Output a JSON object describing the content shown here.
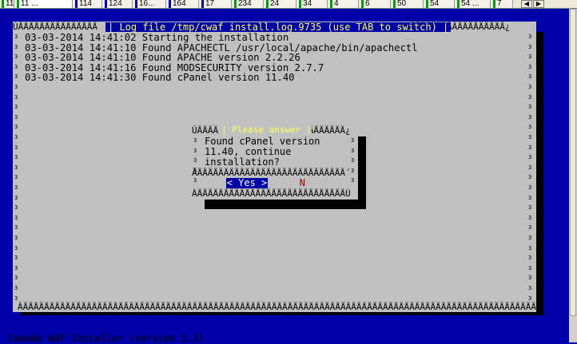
{
  "tabs": [
    {
      "label": "11",
      "mark": "#00a000"
    },
    {
      "label": "11 ...",
      "mark": "#00a000",
      "active": true
    },
    {
      "label": "114",
      "mark": "#0000c0"
    },
    {
      "label": "124",
      "mark": "#0000c0"
    },
    {
      "label": "16...",
      "mark": "#0000c0"
    },
    {
      "label": "164",
      "mark": "#0000c0"
    },
    {
      "label": "17",
      "mark": "#0000c0"
    },
    {
      "label": "234",
      "mark": "#00a000"
    },
    {
      "label": "24",
      "mark": "#00a000"
    },
    {
      "label": "34",
      "mark": "#00a000"
    },
    {
      "label": "4",
      "mark": "#00a000"
    },
    {
      "label": "6",
      "mark": "#00a000"
    },
    {
      "label": "50",
      "mark": "#00a000"
    },
    {
      "label": "54",
      "mark": "#00a000"
    },
    {
      "label": "54 ...",
      "mark": "#00a000"
    },
    {
      "label": "7",
      "mark": "#00a000"
    }
  ],
  "nav": {
    "prev_icon": "◀",
    "next_icon": "▶"
  },
  "log": {
    "title": "| Log file /tmp/cwaf_install.log.9735 (use TAB to switch) |",
    "lines": [
      "03-03-2014 14:41:02 Starting the installation",
      "03-03-2014 14:41:10 Found APACHECTL /usr/local/apache/bin/apachectl",
      "03-03-2014 14:41:10 Found APACHE version 2.2.26",
      "03-03-2014 14:41:16 Found MODSECURITY version 2.7.7",
      "03-03-2014 14:41:30 Found cPanel version 11.40"
    ]
  },
  "dialog": {
    "title": "| Please answer |",
    "lines": [
      "Found cPanel version",
      "11.40, continue",
      "installation?"
    ],
    "yes_label": "< Yes >",
    "no_left": "<  ",
    "no_hot": "N",
    "no_rest": "o  >"
  },
  "status": {
    "text": "Comodo WAF Installer (version 1.3)"
  },
  "colors": {
    "terminal_bg": "#0000a8",
    "window_bg": "#c0c0c0",
    "title_fg": "#ffff55"
  }
}
